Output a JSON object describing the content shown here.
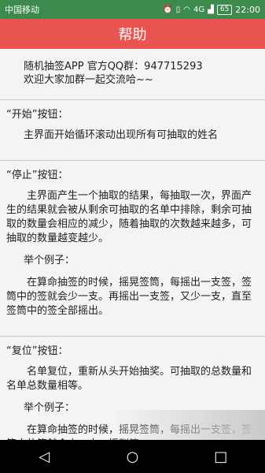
{
  "status_bar": {
    "carrier": "中国移动",
    "signal": "4G",
    "battery": "65",
    "time": "22:00"
  },
  "header": {
    "title": "帮助"
  },
  "intro": {
    "line1": "随机抽签APP 官方QQ群：947715293",
    "line2": "欢迎大家加群一起交流哈~~"
  },
  "sections": [
    {
      "title": "“开始”按钮：",
      "paragraphs": [
        "主界面开始循环滚动出现所有可抽取的姓名"
      ]
    },
    {
      "title": "“停止”按钮：",
      "paragraphs": [
        "主界面产生一个抽取的结果，每抽取一次，界面产生的结果就会被从剩余可抽取的名单中排除，剩余可抽取的数量会相应的减少，随着抽取的次数越来越多，可抽取的数量越变越少。",
        "举个例子：",
        "在算命抽签的时候，摇晃签筒，每摇出一支签，签筒中的签就会少一支。再摇出一支签，又少一支，直至签筒中的签全部摇出。"
      ]
    },
    {
      "title": "“复位”按钮：",
      "paragraphs": [
        "名单复位，重新从头开始抽奖。可抽取的总数量和名单总数量相等。",
        "举个例子：",
        "在算命抽签的时候，摇晃签筒，每摇出一支签，签筒中的签就会少一支。摇到签…"
      ]
    }
  ],
  "nav": {
    "back": "◁",
    "home": "○",
    "recents": "□"
  }
}
